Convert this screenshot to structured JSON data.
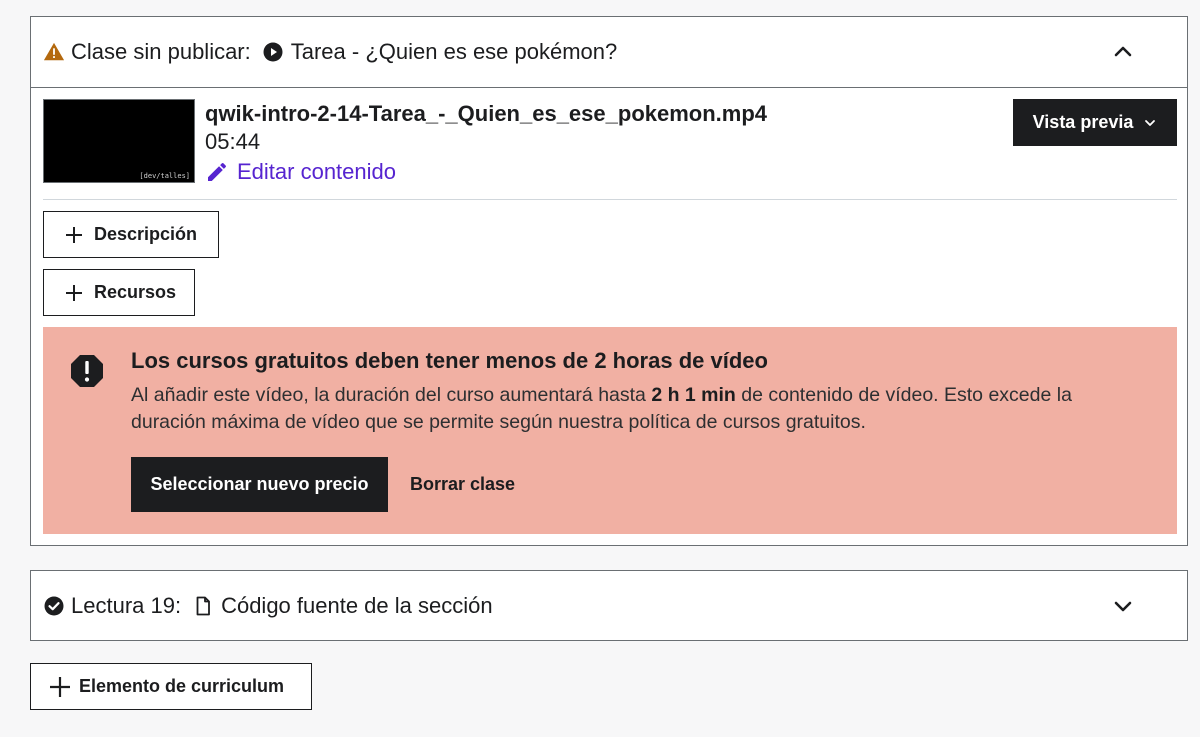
{
  "unpublished_lesson": {
    "status_label": "Clase sin publicar:",
    "status_icon": "warning-icon",
    "type_icon": "play-circle-icon",
    "title": "Tarea - ¿Quien es ese pokémon?",
    "expanded": true,
    "video": {
      "thumbnail_watermark": "[dev/talles]",
      "filename": "qwik-intro-2-14-Tarea_-_Quien_es_ese_pokemon.mp4",
      "duration": "05:44",
      "edit_label": "Editar contenido"
    },
    "preview_button": "Vista previa",
    "add_description": "Descripción",
    "add_resources": "Recursos",
    "alert": {
      "title": "Los cursos gratuitos deben tener menos de 2 horas de vídeo",
      "body_pre": "Al añadir este vídeo, la duración del curso aumentará hasta ",
      "body_bold": "2 h 1 min",
      "body_post": " de contenido de vídeo. Esto excede la duración máxima de vídeo que se permite según nuestra política de cursos gratuitos.",
      "primary_button": "Seleccionar nuevo precio",
      "secondary_button": "Borrar clase",
      "background": "#f1b0a3"
    }
  },
  "lecture_19": {
    "status_label": "Lectura 19:",
    "status_icon": "check-circle-icon",
    "type_icon": "document-icon",
    "title": "Código fuente de la sección",
    "expanded": false
  },
  "add_curriculum_item": "Elemento de curriculum",
  "colors": {
    "accent": "#5624d0",
    "warning": "#b4690e",
    "dark": "#1c1d1f"
  }
}
